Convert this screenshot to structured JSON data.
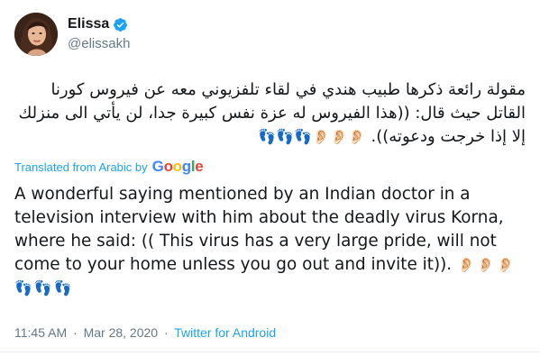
{
  "tweet": {
    "display_name": "Elissa",
    "handle": "@elissakh",
    "arabic_line_1": "مقولة رائعة ذكرها طبيب هندي في لقاء تلفزيوني معه عن فيروس كورنا",
    "arabic_line_2": "القاتل حيث قال: ((هذا الفيروس له عزة نفس كبيرة جدا، لن يأتي الى منزلك",
    "arabic_line_3": "إلا إذا خرجت ودعوته)).",
    "arabic_emoji": "👂🏻👂🏻👂🏻👣👣👣",
    "translated_label": "Translated from Arabic by",
    "google_logo": "Google",
    "english_text": "A wonderful saying mentioned by an Indian doctor in a television interview with him about the deadly virus Korna, where he said: (( This virus has a very large pride, will not come to your home unless you go out and invite it)).",
    "english_emoji": "👂🏻👂🏻👂🏻👣👣👣",
    "time": "11:45 AM",
    "date": "Mar 28, 2020",
    "separator": "·",
    "source": "Twitter for Android"
  },
  "colors": {
    "link": "#1da1f2",
    "muted": "#657786",
    "text": "#14171a",
    "verified": "#1da1f2"
  },
  "icons": {
    "verified": "verified-badge-icon",
    "avatar": "profile-photo"
  }
}
